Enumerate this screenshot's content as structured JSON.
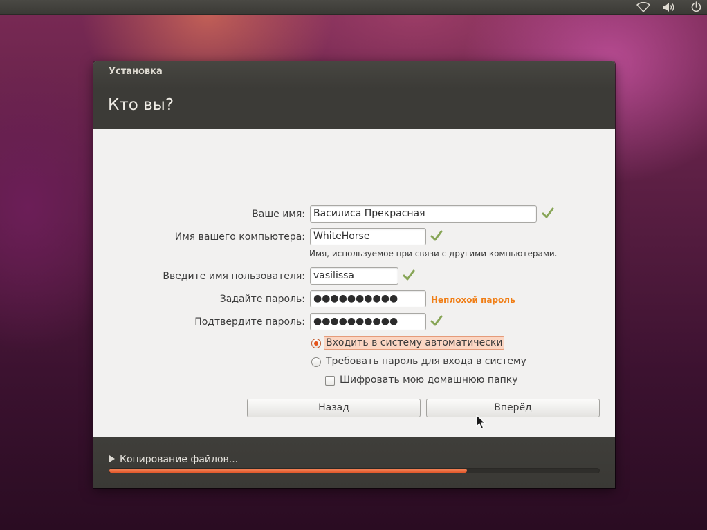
{
  "top_panel": {
    "icons": [
      "wifi-icon",
      "volume-icon",
      "power-icon"
    ]
  },
  "window": {
    "title": "Установка",
    "heading": "Кто вы?"
  },
  "form": {
    "name_label": "Ваше имя:",
    "name_value": "Василиса Прекрасная",
    "computer_label": "Имя вашего компьютера:",
    "computer_value": "WhiteHorse",
    "computer_hint": "Имя, используемое при связи с другими компьютерами.",
    "username_label": "Введите имя пользователя:",
    "username_value": "vasilissa",
    "password_label": "Задайте пароль:",
    "password_value": "●●●●●●●●●●",
    "password_strength": "Неплохой пароль",
    "confirm_label": "Подтвердите пароль:",
    "confirm_value": "●●●●●●●●●●",
    "login_auto": "Входить в систему автоматически",
    "login_password": "Требовать пароль для входа в систему",
    "encrypt_home": "Шифровать мою домашнюю папку",
    "selected_login_option": "login_auto",
    "encrypt_checked": false
  },
  "buttons": {
    "back": "Назад",
    "forward": "Вперёд"
  },
  "footer": {
    "progress_label": "Копирование файлов...",
    "progress_fraction": 0.73
  },
  "colors": {
    "accent": "#e2572a",
    "check_green": "#87a556",
    "strength_orange": "#f07e16"
  }
}
